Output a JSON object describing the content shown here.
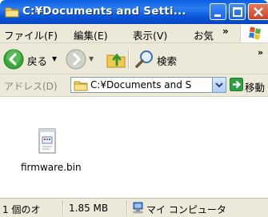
{
  "window": {
    "title": "C:¥Documents and Setti..."
  },
  "menu": {
    "items": [
      "ファイル(F)",
      "編集(E)",
      "表示(V)",
      "お気"
    ],
    "overflow": "»"
  },
  "toolbar": {
    "back_label": "戻る",
    "search_label": "検索",
    "overflow": "»"
  },
  "address": {
    "label": "アドレス(D)",
    "value": "C:¥Documents and S",
    "go_label": "移動"
  },
  "files": [
    {
      "name": "firmware.bin",
      "icon": "bin-file-icon"
    }
  ],
  "status": {
    "count": "1 個のオ",
    "size": "1.85 MB",
    "zone": "マイ コンピュータ"
  },
  "colors": {
    "titlebar": "#0a55d8",
    "chrome": "#ece9d8",
    "back_button": "#3aa63a",
    "go_button": "#2ea043",
    "close_button": "#c8452a"
  }
}
